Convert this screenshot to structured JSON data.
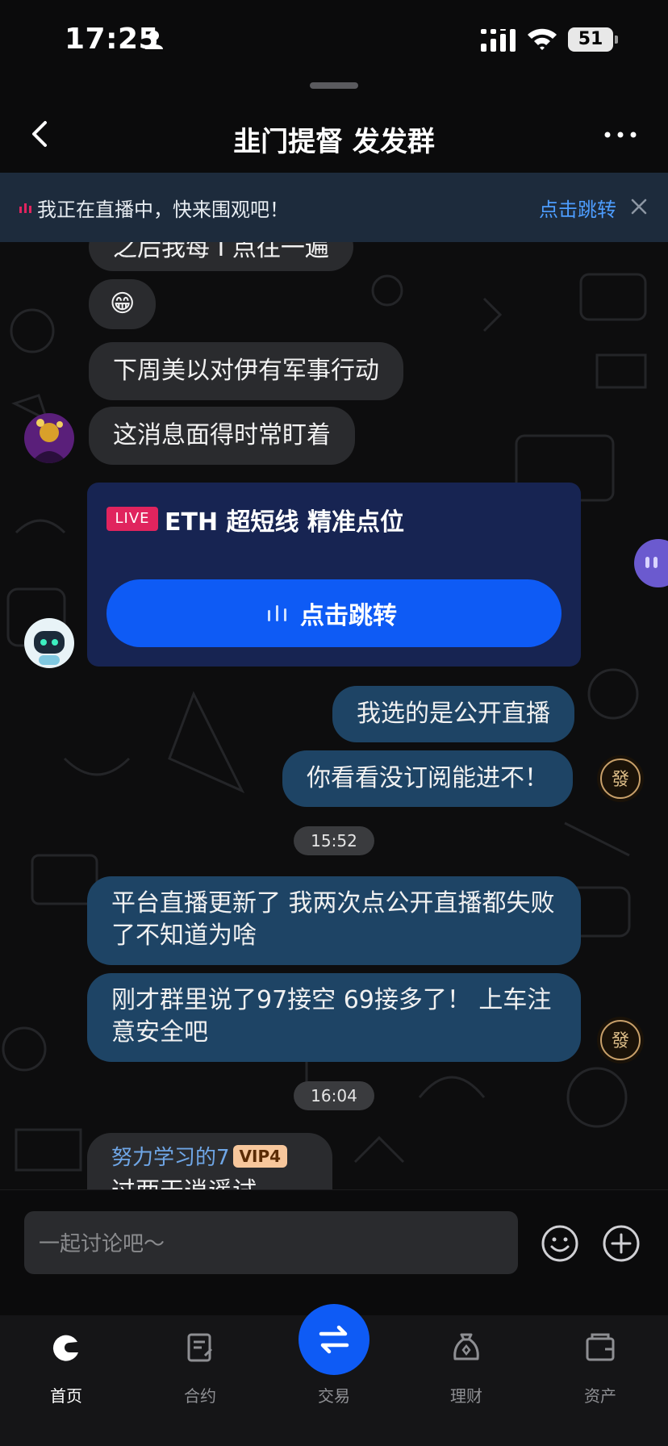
{
  "status_bar": {
    "time": "17:25",
    "battery": "51"
  },
  "header": {
    "title": "韭门提督 发发群"
  },
  "live_banner": {
    "text": "我正在直播中，快来围观吧！",
    "link": "点击跳转"
  },
  "messages": [
    {
      "text": "之后我每 I 点往一遍"
    },
    {
      "text": "😁"
    },
    {
      "text": "下周美以对伊有军事行动"
    },
    {
      "text": "这消息面得时常盯着"
    },
    {
      "text": "我选的是公开直播"
    },
    {
      "text": "你看看没订阅能进不！"
    },
    {
      "text": "平台直播更新了 我两次点公开直播都失败了不知道为啥"
    },
    {
      "text": "刚才群里说了97接空 69接多了！ 上车注意安全吧"
    },
    {
      "text": "过两天逍遥试"
    }
  ],
  "live_card": {
    "badge": "LIVE",
    "title": "ETH 超短线 精准点位",
    "button": "点击跳转"
  },
  "timestamps": {
    "t1": "15:52",
    "t2": "16:04"
  },
  "last_sender": {
    "name": "努力学习的7",
    "vip": "VIP4"
  },
  "avatar_stamp_text": "發",
  "input": {
    "placeholder": "一起讨论吧～"
  },
  "tabs": [
    {
      "label": "首页"
    },
    {
      "label": "合约"
    },
    {
      "label": "交易"
    },
    {
      "label": "理财"
    },
    {
      "label": "资产"
    }
  ],
  "colors": {
    "accent": "#0e5bf5",
    "bubble_right": "#1e4465",
    "bubble_left": "#2a2b2e",
    "link": "#4d9dff",
    "live_badge": "#e0245e"
  }
}
